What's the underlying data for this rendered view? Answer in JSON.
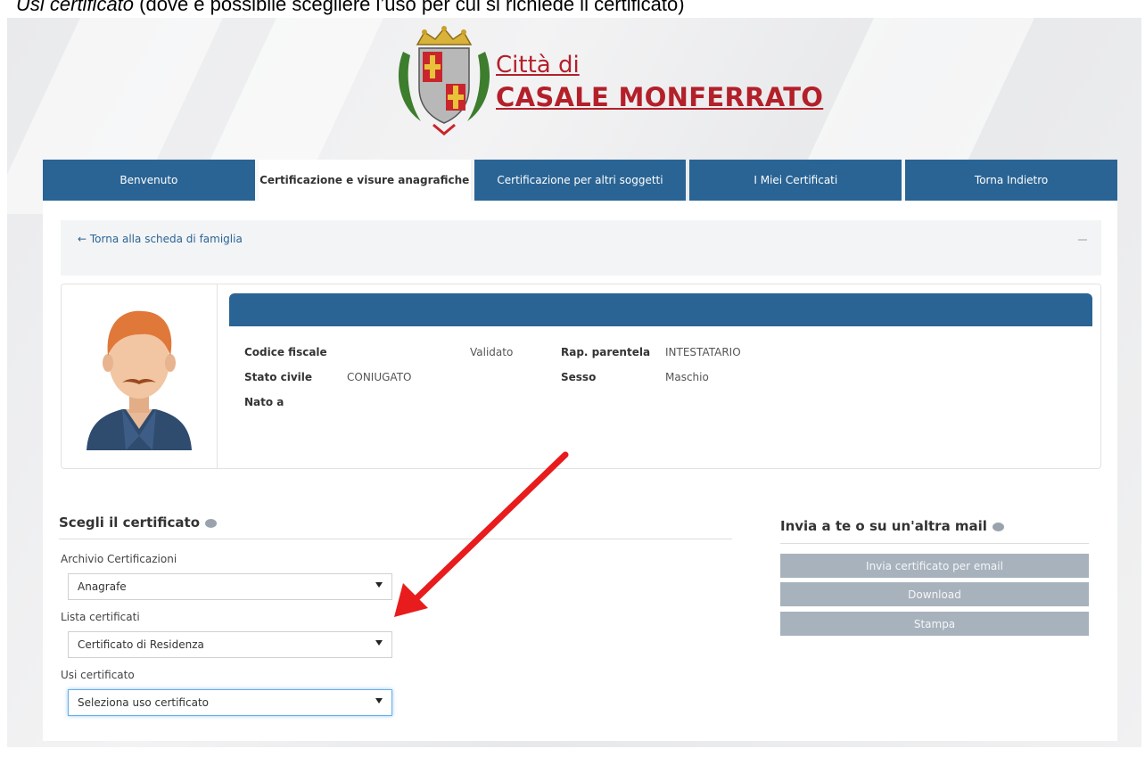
{
  "caption": {
    "italic": "Usi certificato",
    "rest": " (dove è possibile scegliere l’uso per cui si richiede il certificato)"
  },
  "brand": {
    "line1": "Città di",
    "line2": "CASALE MONFERRATO"
  },
  "tabs": [
    {
      "label": "Benvenuto",
      "active": false
    },
    {
      "label": "Certificazione e visure anagrafiche",
      "active": true
    },
    {
      "label": "Certificazione per altri soggetti",
      "active": false
    },
    {
      "label": "I Miei Certificati",
      "active": false
    },
    {
      "label": "Torna Indietro",
      "active": false
    }
  ],
  "back_link": "← Torna alla scheda di famiglia",
  "person": {
    "codice_fiscale_label": "Codice fiscale",
    "codice_fiscale_status": "Validato",
    "rap_parentela_label": "Rap. parentela",
    "rap_parentela_value": "INTESTATARIO",
    "stato_civile_label": "Stato civile",
    "stato_civile_value": "CONIUGATO",
    "sesso_label": "Sesso",
    "sesso_value": "Maschio",
    "nato_a_label": "Nato a"
  },
  "certificate": {
    "title": "Scegli il certificato",
    "archivio_label": "Archivio Certificazioni",
    "archivio_value": "Anagrafe",
    "lista_label": "Lista certificati",
    "lista_value": "Certificato di Residenza",
    "usi_label": "Usi certificato",
    "usi_value": "Seleziona uso certificato"
  },
  "send": {
    "title": "Invia a te o su un'altra mail",
    "email_button": "Invia certificato per email",
    "download_button": "Download",
    "print_button": "Stampa"
  },
  "colors": {
    "brand": "#b3202a",
    "nav": "#2a6494",
    "button": "#a8b2bd",
    "arrow": "#e81c1c"
  }
}
